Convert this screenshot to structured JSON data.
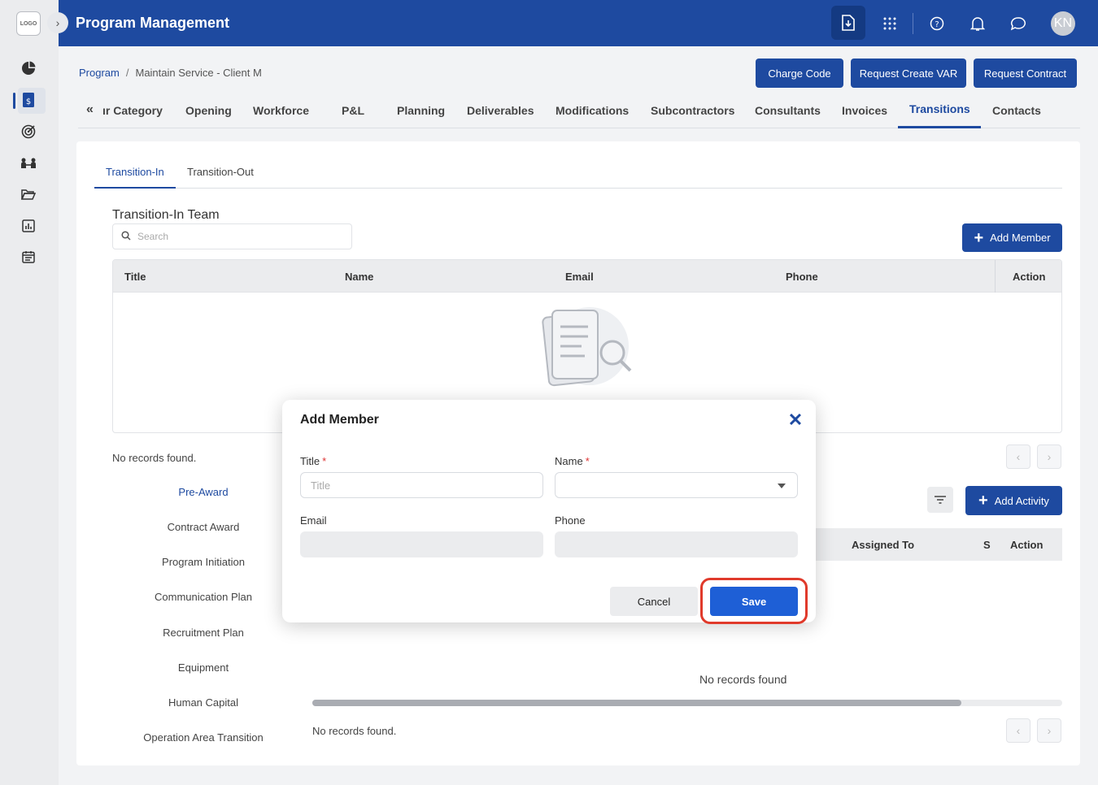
{
  "sidebar": {
    "logo_text": "LOGO",
    "icons": [
      "pie-chart-icon",
      "document-dollar-icon",
      "target-icon",
      "team-icon",
      "folder-open-icon",
      "report-chart-icon",
      "calendar-icon"
    ]
  },
  "header": {
    "expand_glyph": "›",
    "title": "Program Management",
    "avatar_initials": "KN",
    "icons": [
      "download-document-icon",
      "apps-grid-icon",
      "help-icon",
      "bell-icon",
      "chat-icon"
    ]
  },
  "breadcrumb": {
    "root": "Program",
    "separator": "/",
    "current": "Maintain Service - Client M"
  },
  "top_buttons": {
    "charge_code": "Charge Code",
    "request_create_var": "Request Create VAR",
    "request_contract": "Request Contract"
  },
  "tabs": {
    "collapse_glyph": "«",
    "items": [
      "ır Category",
      "Opening",
      "Workforce",
      "P&L",
      "Planning",
      "Deliverables",
      "Modifications",
      "Subcontractors",
      "Consultants",
      "Invoices",
      "Transitions",
      "Contacts"
    ],
    "active": "Transitions"
  },
  "subtabs": {
    "transition_in": "Transition-In",
    "transition_out": "Transition-Out"
  },
  "team_section": {
    "title": "Transition-In Team",
    "search_placeholder": "Search",
    "add_member_label": "Add Member",
    "columns": [
      "Title",
      "Name",
      "Email",
      "Phone",
      "Action"
    ],
    "no_records": "No records found."
  },
  "phases": {
    "items": [
      "Pre-Award",
      "Contract Award",
      "Program Initiation",
      "Communication Plan",
      "Recruitment Plan",
      "Equipment",
      "Human Capital",
      "Operation Area Transition"
    ],
    "active": "Pre-Award"
  },
  "activity_section": {
    "add_activity_label": "Add Activity",
    "columns": [
      "Assigned To",
      "S",
      "Action"
    ],
    "empty_text": "No records found",
    "no_records": "No records found.",
    "scrollbar_fraction": 0.865
  },
  "pager": {
    "prev": "‹",
    "next": "›"
  },
  "modal": {
    "title": "Add Member",
    "close_glyph": "✕",
    "title_label": "Title",
    "title_placeholder": "Title",
    "name_label": "Name",
    "email_label": "Email",
    "phone_label": "Phone",
    "required_mark": "*",
    "cancel_label": "Cancel",
    "save_label": "Save"
  },
  "colors": {
    "brand": "#1e4aa0",
    "save_button": "#1e5fd6",
    "highlight": "#e03a2b"
  }
}
